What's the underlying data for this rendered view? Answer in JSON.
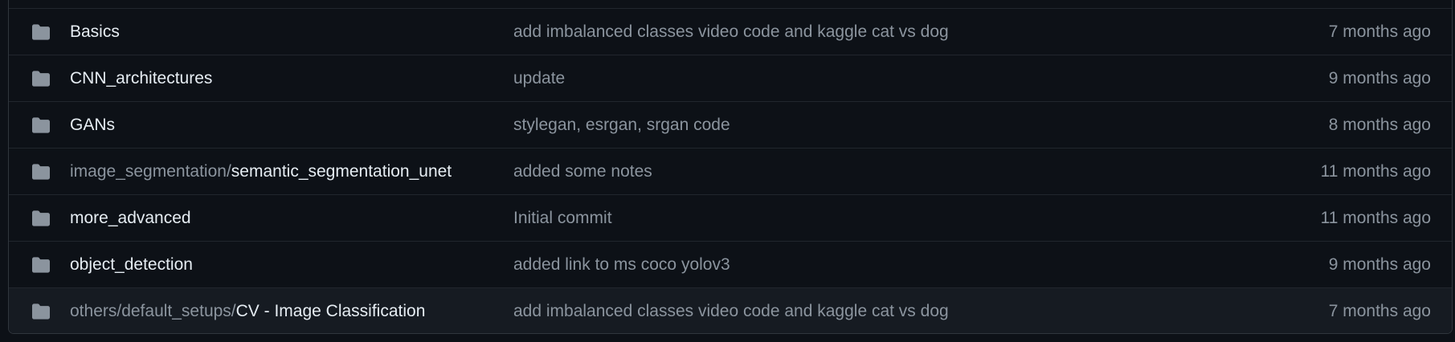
{
  "colors": {
    "background": "#0d1117",
    "border": "#30363d",
    "divider": "#21262d",
    "hover_row": "#161b22",
    "text_primary": "#e6edf3",
    "text_muted": "#8b949e",
    "folder_icon": "#8b949e"
  },
  "rows": [
    {
      "icon": "folder-icon",
      "prefix": "",
      "name": "Basics",
      "message": "add imbalanced classes video code and kaggle cat vs dog",
      "age": "7 months ago"
    },
    {
      "icon": "folder-icon",
      "prefix": "",
      "name": "CNN_architectures",
      "message": "update",
      "age": "9 months ago"
    },
    {
      "icon": "folder-icon",
      "prefix": "",
      "name": "GANs",
      "message": "stylegan, esrgan, srgan code",
      "age": "8 months ago"
    },
    {
      "icon": "folder-icon",
      "prefix": "image_segmentation/",
      "name": "semantic_segmentation_unet",
      "message": "added some notes",
      "age": "11 months ago"
    },
    {
      "icon": "folder-icon",
      "prefix": "",
      "name": "more_advanced",
      "message": "Initial commit",
      "age": "11 months ago"
    },
    {
      "icon": "folder-icon",
      "prefix": "",
      "name": "object_detection",
      "message": "added link to ms coco yolov3",
      "age": "9 months ago"
    },
    {
      "icon": "folder-icon",
      "prefix": "others/default_setups/",
      "name": "CV - Image Classification",
      "message": "add imbalanced classes video code and kaggle cat vs dog",
      "age": "7 months ago"
    }
  ]
}
